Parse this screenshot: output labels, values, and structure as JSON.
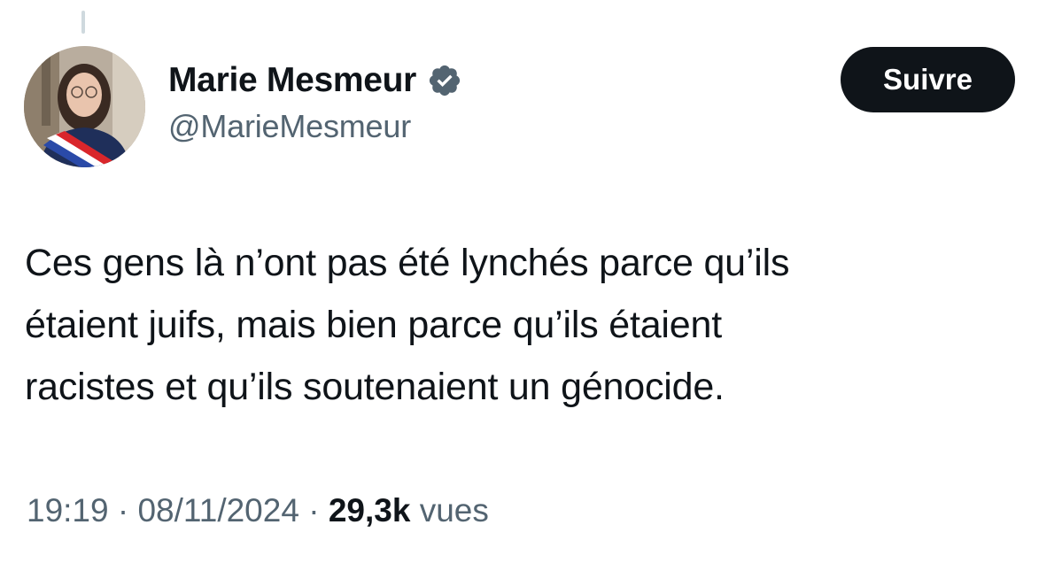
{
  "author": {
    "display_name": "Marie Mesmeur",
    "handle": "@MarieMesmeur",
    "verified_icon": "verified-badge-icon",
    "verified_color": "#536471"
  },
  "follow_button": {
    "label": "Suivre",
    "background": "#0f1419"
  },
  "tweet": {
    "lines": [
      "Ces gens là n’ont pas été lynchés parce qu’ils",
      "étaient juifs, mais bien parce qu’ils étaient",
      "racistes et qu’ils soutenaient un génocide."
    ]
  },
  "meta": {
    "time": "19:19",
    "separator": " · ",
    "date": "08/11/2024",
    "views_count": "29,3k",
    "views_label": "vues"
  }
}
